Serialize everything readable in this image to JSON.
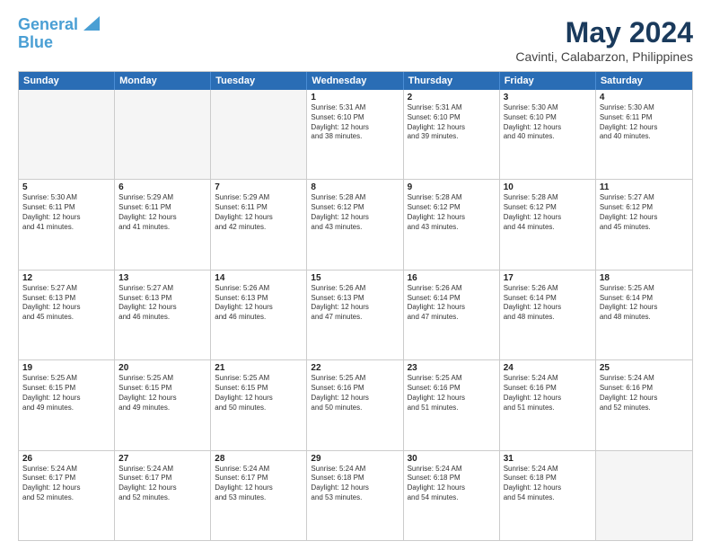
{
  "header": {
    "logo_line1": "General",
    "logo_line2": "Blue",
    "title": "May 2024",
    "subtitle": "Cavinti, Calabarzon, Philippines"
  },
  "days_of_week": [
    "Sunday",
    "Monday",
    "Tuesday",
    "Wednesday",
    "Thursday",
    "Friday",
    "Saturday"
  ],
  "weeks": [
    [
      {
        "day": "",
        "info": "",
        "empty": true
      },
      {
        "day": "",
        "info": "",
        "empty": true
      },
      {
        "day": "",
        "info": "",
        "empty": true
      },
      {
        "day": "1",
        "info": "Sunrise: 5:31 AM\nSunset: 6:10 PM\nDaylight: 12 hours\nand 38 minutes."
      },
      {
        "day": "2",
        "info": "Sunrise: 5:31 AM\nSunset: 6:10 PM\nDaylight: 12 hours\nand 39 minutes."
      },
      {
        "day": "3",
        "info": "Sunrise: 5:30 AM\nSunset: 6:10 PM\nDaylight: 12 hours\nand 40 minutes."
      },
      {
        "day": "4",
        "info": "Sunrise: 5:30 AM\nSunset: 6:11 PM\nDaylight: 12 hours\nand 40 minutes."
      }
    ],
    [
      {
        "day": "5",
        "info": "Sunrise: 5:30 AM\nSunset: 6:11 PM\nDaylight: 12 hours\nand 41 minutes."
      },
      {
        "day": "6",
        "info": "Sunrise: 5:29 AM\nSunset: 6:11 PM\nDaylight: 12 hours\nand 41 minutes."
      },
      {
        "day": "7",
        "info": "Sunrise: 5:29 AM\nSunset: 6:11 PM\nDaylight: 12 hours\nand 42 minutes."
      },
      {
        "day": "8",
        "info": "Sunrise: 5:28 AM\nSunset: 6:12 PM\nDaylight: 12 hours\nand 43 minutes."
      },
      {
        "day": "9",
        "info": "Sunrise: 5:28 AM\nSunset: 6:12 PM\nDaylight: 12 hours\nand 43 minutes."
      },
      {
        "day": "10",
        "info": "Sunrise: 5:28 AM\nSunset: 6:12 PM\nDaylight: 12 hours\nand 44 minutes."
      },
      {
        "day": "11",
        "info": "Sunrise: 5:27 AM\nSunset: 6:12 PM\nDaylight: 12 hours\nand 45 minutes."
      }
    ],
    [
      {
        "day": "12",
        "info": "Sunrise: 5:27 AM\nSunset: 6:13 PM\nDaylight: 12 hours\nand 45 minutes."
      },
      {
        "day": "13",
        "info": "Sunrise: 5:27 AM\nSunset: 6:13 PM\nDaylight: 12 hours\nand 46 minutes."
      },
      {
        "day": "14",
        "info": "Sunrise: 5:26 AM\nSunset: 6:13 PM\nDaylight: 12 hours\nand 46 minutes."
      },
      {
        "day": "15",
        "info": "Sunrise: 5:26 AM\nSunset: 6:13 PM\nDaylight: 12 hours\nand 47 minutes."
      },
      {
        "day": "16",
        "info": "Sunrise: 5:26 AM\nSunset: 6:14 PM\nDaylight: 12 hours\nand 47 minutes."
      },
      {
        "day": "17",
        "info": "Sunrise: 5:26 AM\nSunset: 6:14 PM\nDaylight: 12 hours\nand 48 minutes."
      },
      {
        "day": "18",
        "info": "Sunrise: 5:25 AM\nSunset: 6:14 PM\nDaylight: 12 hours\nand 48 minutes."
      }
    ],
    [
      {
        "day": "19",
        "info": "Sunrise: 5:25 AM\nSunset: 6:15 PM\nDaylight: 12 hours\nand 49 minutes."
      },
      {
        "day": "20",
        "info": "Sunrise: 5:25 AM\nSunset: 6:15 PM\nDaylight: 12 hours\nand 49 minutes."
      },
      {
        "day": "21",
        "info": "Sunrise: 5:25 AM\nSunset: 6:15 PM\nDaylight: 12 hours\nand 50 minutes."
      },
      {
        "day": "22",
        "info": "Sunrise: 5:25 AM\nSunset: 6:16 PM\nDaylight: 12 hours\nand 50 minutes."
      },
      {
        "day": "23",
        "info": "Sunrise: 5:25 AM\nSunset: 6:16 PM\nDaylight: 12 hours\nand 51 minutes."
      },
      {
        "day": "24",
        "info": "Sunrise: 5:24 AM\nSunset: 6:16 PM\nDaylight: 12 hours\nand 51 minutes."
      },
      {
        "day": "25",
        "info": "Sunrise: 5:24 AM\nSunset: 6:16 PM\nDaylight: 12 hours\nand 52 minutes."
      }
    ],
    [
      {
        "day": "26",
        "info": "Sunrise: 5:24 AM\nSunset: 6:17 PM\nDaylight: 12 hours\nand 52 minutes."
      },
      {
        "day": "27",
        "info": "Sunrise: 5:24 AM\nSunset: 6:17 PM\nDaylight: 12 hours\nand 52 minutes."
      },
      {
        "day": "28",
        "info": "Sunrise: 5:24 AM\nSunset: 6:17 PM\nDaylight: 12 hours\nand 53 minutes."
      },
      {
        "day": "29",
        "info": "Sunrise: 5:24 AM\nSunset: 6:18 PM\nDaylight: 12 hours\nand 53 minutes."
      },
      {
        "day": "30",
        "info": "Sunrise: 5:24 AM\nSunset: 6:18 PM\nDaylight: 12 hours\nand 54 minutes."
      },
      {
        "day": "31",
        "info": "Sunrise: 5:24 AM\nSunset: 6:18 PM\nDaylight: 12 hours\nand 54 minutes."
      },
      {
        "day": "",
        "info": "",
        "empty": true
      }
    ]
  ]
}
